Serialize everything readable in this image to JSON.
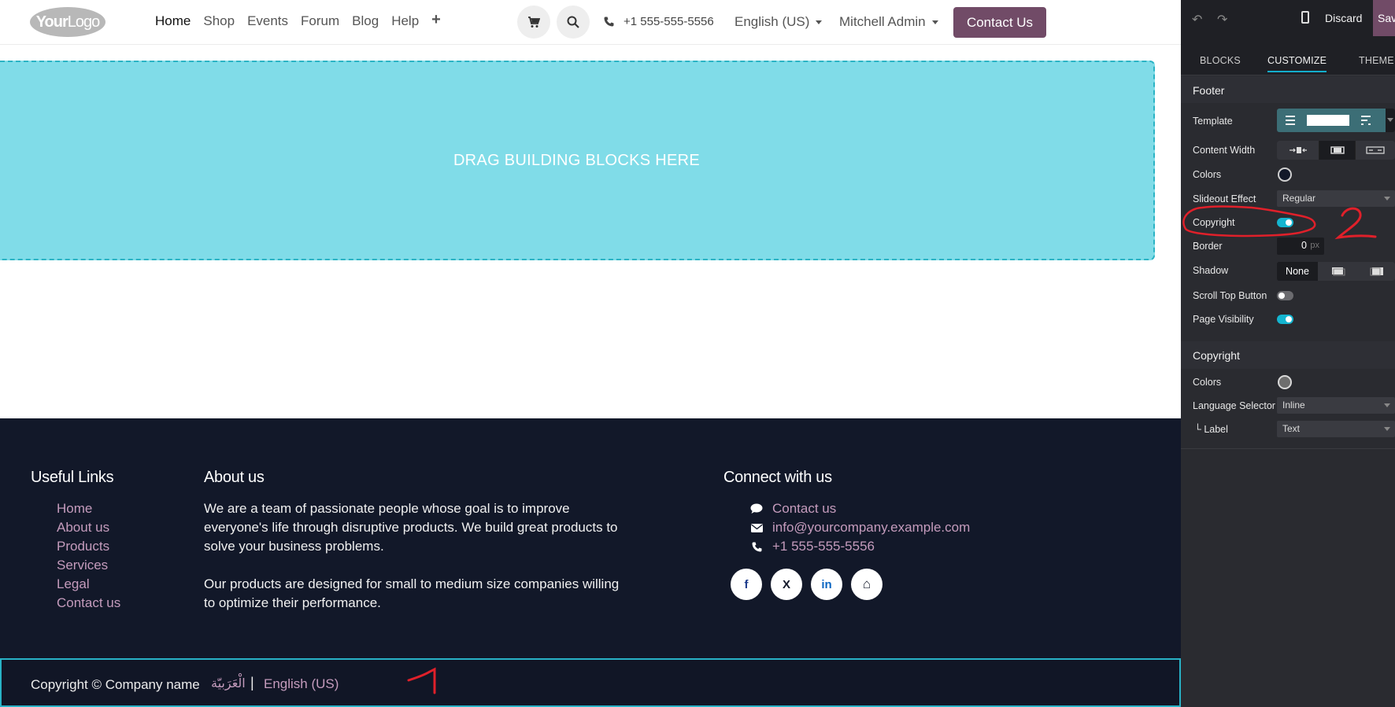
{
  "site": {
    "logo": {
      "bold": "Your",
      "rest": "Logo"
    },
    "nav": [
      {
        "label": "Home",
        "active": true
      },
      {
        "label": "Shop",
        "active": false
      },
      {
        "label": "Events",
        "active": false
      },
      {
        "label": "Forum",
        "active": false
      },
      {
        "label": "Blog",
        "active": false
      },
      {
        "label": "Help",
        "active": false
      }
    ],
    "add_label": "+",
    "phone": "+1 555-555-5556",
    "language": "English (US)",
    "user": "Mitchell Admin",
    "contact_button": "Contact Us",
    "dropzone_text": "DRAG BUILDING BLOCKS HERE"
  },
  "footer": {
    "useful_links": {
      "title": "Useful Links",
      "items": [
        "Home",
        "About us",
        "Products",
        "Services",
        "Legal",
        "Contact us"
      ]
    },
    "about": {
      "title": "About us",
      "p1": "We are a team of passionate people whose goal is to improve everyone's life through disruptive products. We build great products to solve your business problems.",
      "p2": "Our products are designed for small to medium size companies willing to optimize their performance."
    },
    "connect": {
      "title": "Connect with us",
      "contact": "Contact us",
      "email": "info@yourcompany.example.com",
      "phone": "+1 555-555-5556",
      "socials": [
        "f",
        "X",
        "in",
        "⌂"
      ]
    },
    "copyright": {
      "text": "Copyright © Company name",
      "lang_ar": "الْعَرَبيّة",
      "separator": "|",
      "lang_en": "English (US)"
    }
  },
  "panel": {
    "discard": "Discard",
    "save": "Save",
    "tabs": {
      "blocks": "BLOCKS",
      "customize": "CUSTOMIZE",
      "theme": "THEME"
    },
    "footer_section": {
      "title": "Footer",
      "template": "Template",
      "content_width": "Content Width",
      "colors": "Colors",
      "slideout_effect": "Slideout Effect",
      "slideout_value": "Regular",
      "copyright": "Copyright",
      "copyright_on": true,
      "border": "Border",
      "border_value": "0",
      "border_unit": "px",
      "shadow": "Shadow",
      "shadow_value": "None",
      "scroll_top_button": "Scroll Top Button",
      "scroll_top_on": false,
      "page_visibility": "Page Visibility",
      "page_visibility_on": true
    },
    "copyright_section": {
      "title": "Copyright",
      "colors": "Colors",
      "language_selector": "Language Selector",
      "language_selector_value": "Inline",
      "label": "└ Label",
      "label_value": "Text"
    }
  },
  "colors": {
    "brand": "#714b67",
    "accent": "#13aecc",
    "footer_bg": "#121829",
    "link": "#c49bbc",
    "annotation": "#e0202a"
  },
  "annotations": {
    "mark_1": "1",
    "mark_2": "2"
  }
}
